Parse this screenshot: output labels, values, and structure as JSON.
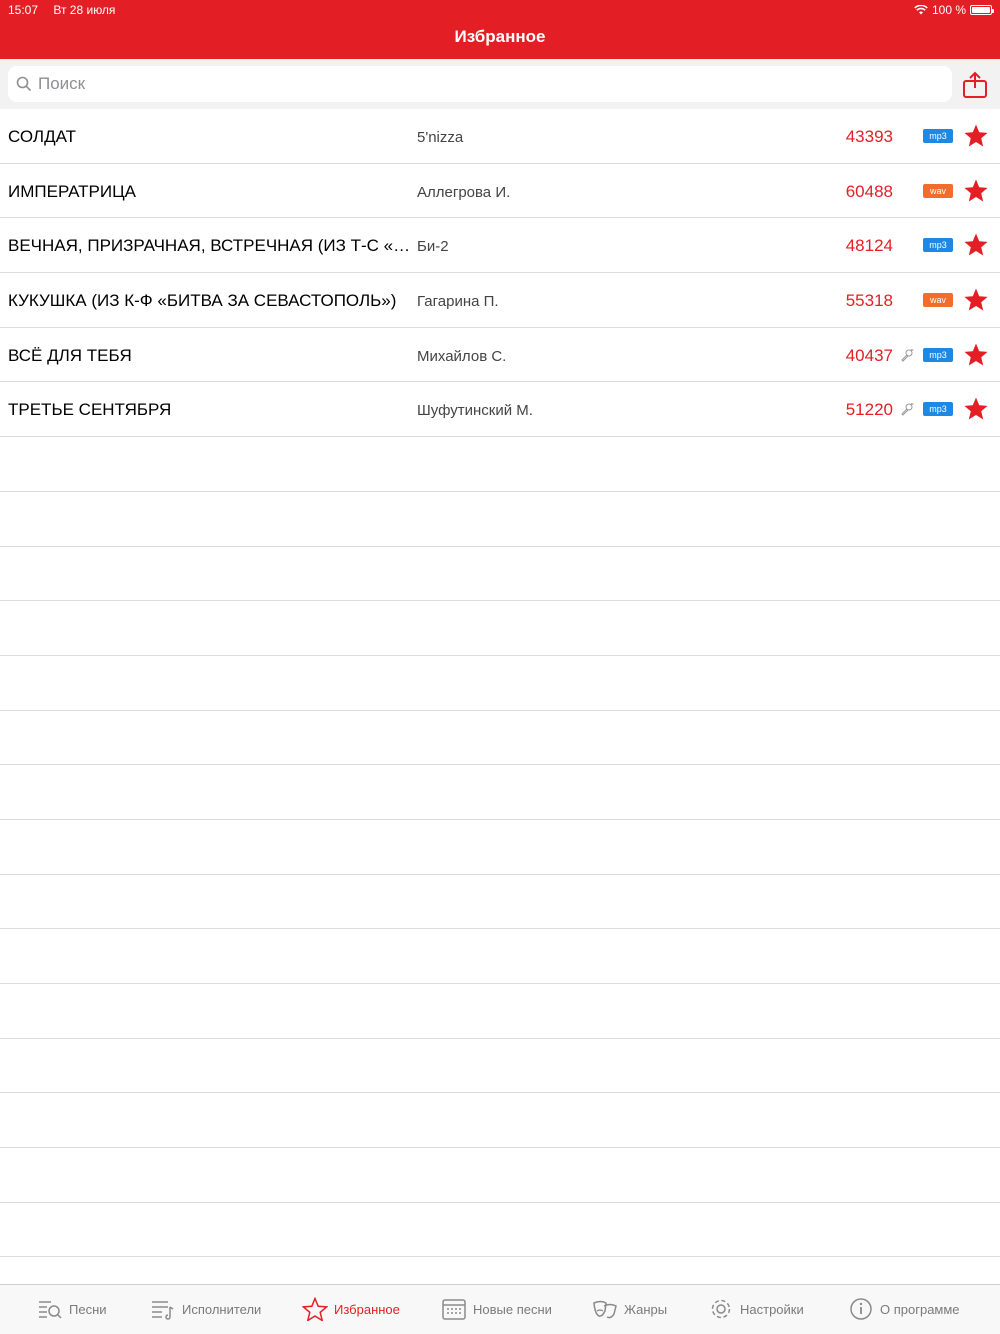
{
  "status": {
    "time": "15:07",
    "date": "Вт 28 июля",
    "battery": "100 %"
  },
  "header": {
    "title": "Избранное"
  },
  "search": {
    "placeholder": "Поиск"
  },
  "colors": {
    "accent": "#e31e25",
    "mp3": "#1e88e5",
    "wav": "#f26d2b"
  },
  "songs": [
    {
      "title": "СОЛДАТ",
      "artist": "5'nizza",
      "number": "43393",
      "format": "mp3",
      "mic": false
    },
    {
      "title": "ИМПЕРАТРИЦА",
      "artist": "Аллегрова И.",
      "number": "60488",
      "format": "wav",
      "mic": false
    },
    {
      "title": "ВЕЧНАЯ, ПРИЗРАЧНАЯ, ВСТРЕЧНАЯ (ИЗ Т-С «НА...",
      "artist": "Би-2",
      "number": "48124",
      "format": "mp3",
      "mic": false
    },
    {
      "title": "КУКУШКА (ИЗ К-Ф «БИТВА ЗА СЕВАСТОПОЛЬ»)",
      "artist": "Гагарина П.",
      "number": "55318",
      "format": "wav",
      "mic": false
    },
    {
      "title": "ВСЁ ДЛЯ ТЕБЯ",
      "artist": "Михайлов С.",
      "number": "40437",
      "format": "mp3",
      "mic": true
    },
    {
      "title": "ТРЕТЬЕ СЕНТЯБРЯ",
      "artist": "Шуфутинский М.",
      "number": "51220",
      "format": "mp3",
      "mic": true
    }
  ],
  "tabs": [
    {
      "label": "Песни",
      "icon": "songs-icon"
    },
    {
      "label": "Исполнители",
      "icon": "artists-icon"
    },
    {
      "label": "Избранное",
      "icon": "star-icon"
    },
    {
      "label": "Новые песни",
      "icon": "calendar-icon"
    },
    {
      "label": "Жанры",
      "icon": "masks-icon"
    },
    {
      "label": "Настройки",
      "icon": "gear-icon"
    },
    {
      "label": "О программе",
      "icon": "info-icon"
    }
  ]
}
